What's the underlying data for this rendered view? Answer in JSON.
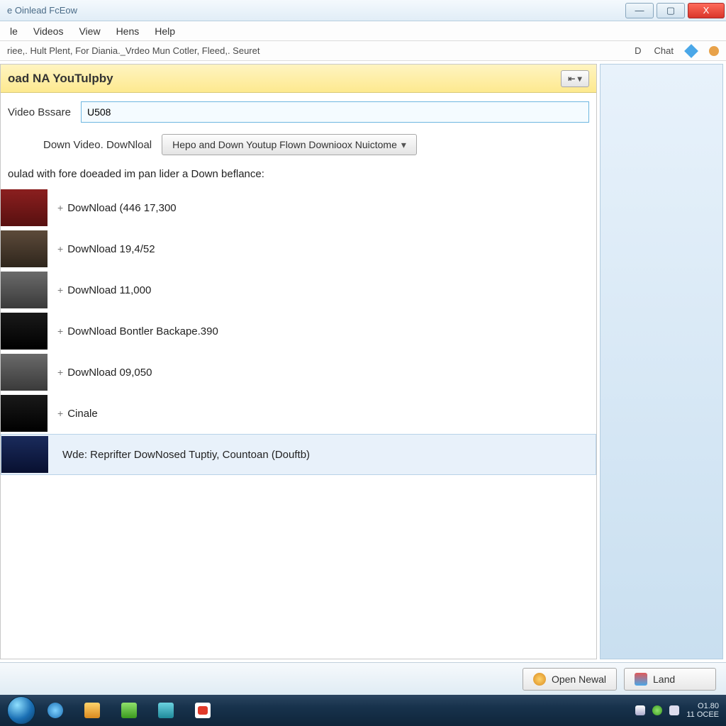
{
  "title": "e Oinlead FcEow",
  "menu": [
    "le",
    "Videos",
    "View",
    "Hens",
    "Help"
  ],
  "toolbar_text": "riee,. Hult Plent, For Diania._Vrdeo Mun Cotler, Fleed,. Seuret",
  "toolbar_d": "D",
  "toolbar_chat": "Chat",
  "header": "oad NA YouTulpby",
  "collapse_label": "⇤ ▾",
  "field_label": "Video Bssare",
  "field_value": "U508",
  "download_label": "Down Video. DowNloal",
  "dropdown_label": "Hepo and Down Youtup Flown Downioox Nuictome",
  "instruction": "oulad with fore doeaded im pan lider a Down beflance:",
  "items": [
    {
      "label": "DowNload (446 17,300",
      "thumb": "red"
    },
    {
      "label": "DowNload 19,4/52",
      "thumb": "brown"
    },
    {
      "label": "DowNload 11,000",
      "thumb": "grey"
    },
    {
      "label": "DowNload Bontler Backape.390",
      "thumb": "dark"
    },
    {
      "label": "DowNload 09,050",
      "thumb": "grey"
    },
    {
      "label": "Cinale",
      "thumb": "dark"
    }
  ],
  "selected_item": "Wde: Reprifter DowNosed Tuptiy, Countoan (Douftb)",
  "btn_open": "Open Newal",
  "btn_land": "Land",
  "winbtns": {
    "min": "—",
    "max": "▢",
    "close": "X"
  },
  "tray": {
    "time": "O1.80",
    "date": "11 OCEE"
  }
}
